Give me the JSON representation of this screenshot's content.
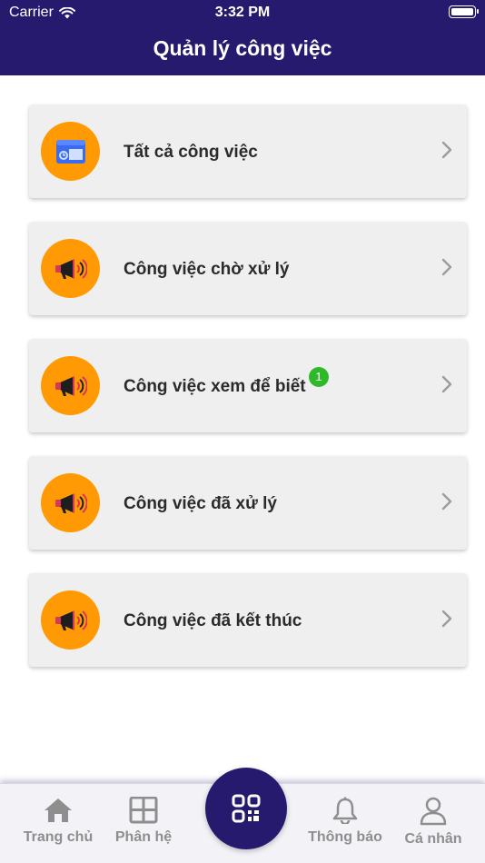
{
  "status_bar": {
    "carrier": "Carrier",
    "time": "3:32 PM"
  },
  "header": {
    "title": "Quản lý công việc"
  },
  "items": [
    {
      "label": "Tất cả công việc",
      "icon": "calendar-window-icon"
    },
    {
      "label": "Công việc chờ xử lý",
      "icon": "megaphone-icon"
    },
    {
      "label": "Công việc xem để biết",
      "icon": "megaphone-icon",
      "badge": "1"
    },
    {
      "label": "Công việc đã xử lý",
      "icon": "megaphone-icon"
    },
    {
      "label": "Công việc đã kết thúc",
      "icon": "megaphone-icon"
    }
  ],
  "tabbar": {
    "home": "Trang chủ",
    "modules": "Phân hệ",
    "notifications": "Thông báo",
    "profile": "Cá nhân"
  },
  "colors": {
    "header": "#261a6e",
    "icon_bg": "#ff9a05",
    "badge": "#2fb82a",
    "tab_inactive": "#8e8e8e"
  }
}
